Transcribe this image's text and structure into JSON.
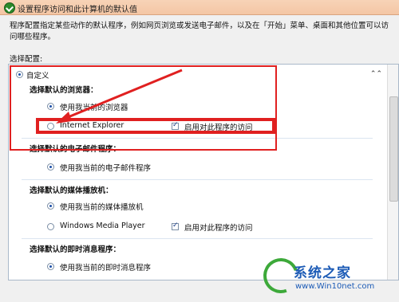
{
  "window": {
    "title": "设置程序访问和此计算机的默认值"
  },
  "description": "程序配置指定某些动作的默认程序，例如网页浏览或发送电子邮件，以及在「开始」菜单、桌面和其他位置可以访问哪些程序。",
  "select_config_label": "选择配置:",
  "config": {
    "name": "自定义",
    "collapse_glyph": "⌃⌃",
    "sections": {
      "browser": {
        "heading": "选择默认的浏览器：",
        "opt_current": "使用我当前的浏览器",
        "opt_ie": "Internet Explorer",
        "enable_access": "启用对此程序的访问"
      },
      "email": {
        "heading": "选择默认的电子邮件程序：",
        "opt_current": "使用我当前的电子邮件程序"
      },
      "media": {
        "heading": "选择默认的媒体播放机：",
        "opt_current": "使用我当前的媒体播放机",
        "opt_wmp": "Windows Media Player",
        "enable_access": "启用对此程序的访问"
      },
      "im": {
        "heading": "选择默认的即时消息程序：",
        "opt_current": "使用我当前的即时消息程序"
      }
    }
  },
  "watermark": {
    "brand": "系统之家",
    "url": "www.Win10net.com",
    "logo": "win10-logo"
  },
  "colors": {
    "annotation": "#e02020",
    "brand": "#1c5bb6"
  }
}
